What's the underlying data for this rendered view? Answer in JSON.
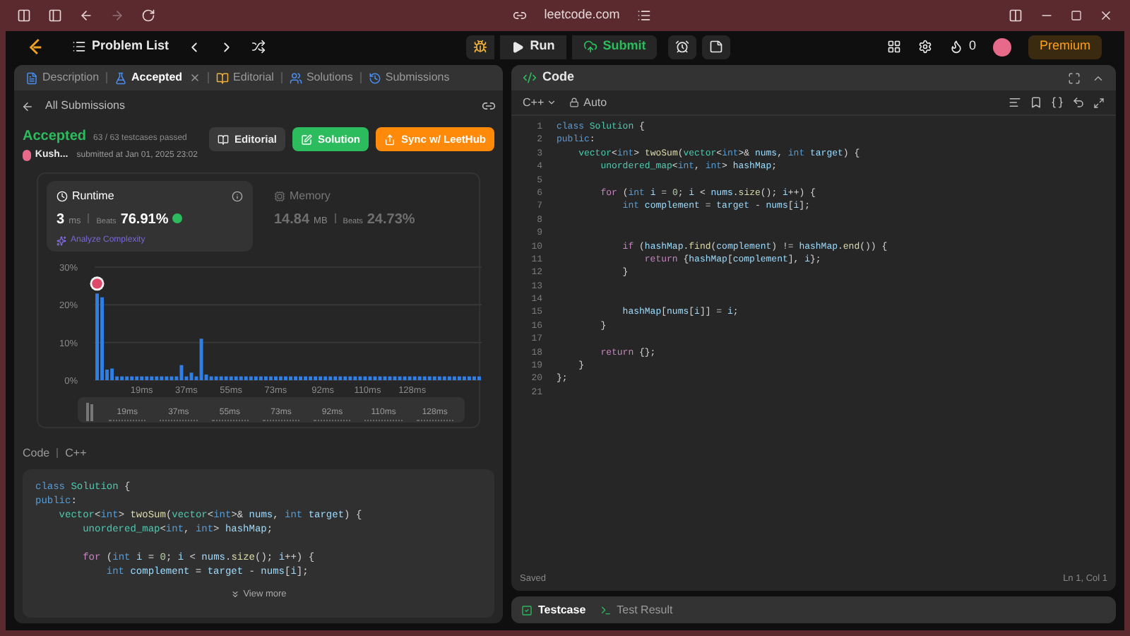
{
  "browser": {
    "url": "leetcode.com"
  },
  "nav": {
    "problem_list": "Problem List",
    "run": "Run",
    "submit": "Submit",
    "streak": "0",
    "premium": "Premium"
  },
  "left": {
    "tabs": [
      {
        "label": "Description",
        "selected": false,
        "closable": false
      },
      {
        "label": "Accepted",
        "selected": true,
        "closable": true
      },
      {
        "label": "Editorial",
        "selected": false,
        "closable": false
      },
      {
        "label": "Solutions",
        "selected": false,
        "closable": false
      },
      {
        "label": "Submissions",
        "selected": false,
        "closable": false
      }
    ],
    "back": "All Submissions",
    "status": "Accepted",
    "testcases": "63 / 63 testcases passed",
    "user": "Kush...",
    "submitted": "submitted at Jan 01, 2025 23:02",
    "actions": [
      {
        "label": "Editorial",
        "kind": "neutral"
      },
      {
        "label": "Solution",
        "kind": "green"
      },
      {
        "label": "Sync w/ LeetHub",
        "kind": "orange"
      }
    ],
    "stats": [
      {
        "title": "Runtime",
        "value": "3",
        "unit": "ms",
        "beats_label": "Beats",
        "beats": "76.91%",
        "selected": true,
        "link": "Analyze Complexity"
      },
      {
        "title": "Memory",
        "value": "14.84",
        "unit": "MB",
        "beats_label": "Beats",
        "beats": "24.73%",
        "selected": false
      }
    ],
    "chart_data": {
      "type": "bar",
      "xlim": [
        0,
        156
      ],
      "ylim": [
        0,
        30
      ],
      "yticks": [
        {
          "value": 0,
          "label": "0%"
        },
        {
          "value": 10,
          "label": "10%"
        },
        {
          "value": 20,
          "label": "20%"
        },
        {
          "value": 30,
          "label": "30%"
        }
      ],
      "xticks": [
        {
          "value": 19,
          "label": "19ms"
        },
        {
          "value": 37,
          "label": "37ms"
        },
        {
          "value": 55,
          "label": "55ms"
        },
        {
          "value": 73,
          "label": "73ms"
        },
        {
          "value": 92,
          "label": "92ms"
        },
        {
          "value": 110,
          "label": "110ms"
        },
        {
          "value": 128,
          "label": "128ms"
        }
      ],
      "x": [
        1,
        3,
        5,
        7,
        9,
        11,
        13,
        15,
        17,
        19,
        21,
        23,
        25,
        27,
        29,
        31,
        33,
        35,
        37,
        39,
        41,
        43,
        45,
        47,
        49,
        51,
        53,
        55,
        57,
        59,
        61,
        63,
        65,
        67,
        69,
        71,
        73,
        75,
        77,
        79,
        81,
        83,
        85,
        87,
        89,
        91,
        93,
        95,
        97,
        99,
        101,
        103,
        105,
        107,
        109,
        111,
        113,
        115,
        117,
        119,
        121,
        123,
        125,
        127,
        129,
        131,
        133,
        135,
        137,
        139,
        141,
        143,
        145,
        147,
        149,
        151,
        153,
        155
      ],
      "series": [
        {
          "color": "#2f7fe6",
          "values": [
            23,
            22,
            2.8,
            3.1,
            1,
            1,
            1,
            1,
            1,
            1,
            1,
            1,
            1,
            1,
            1,
            1,
            1,
            4,
            1,
            2,
            1,
            11,
            1.5,
            1,
            1,
            1,
            1,
            1,
            1,
            1,
            1,
            1,
            1,
            1,
            1,
            1,
            1,
            1,
            1,
            1,
            1,
            1,
            1,
            1,
            1,
            1,
            1,
            1,
            1,
            1,
            1,
            1,
            1,
            1,
            1,
            1,
            1,
            1,
            1,
            1,
            1,
            1,
            1,
            1,
            1,
            1,
            1,
            1,
            1,
            1,
            1,
            1,
            1,
            1,
            1,
            1,
            1,
            1
          ]
        }
      ]
    },
    "brush_labels": [
      "19ms",
      "37ms",
      "55ms",
      "73ms",
      "92ms",
      "110ms",
      "128ms"
    ],
    "code_label": "Code",
    "language": "C++",
    "code": [
      {
        "tokens": [
          {
            "kind": "k",
            "text": "class "
          },
          {
            "kind": "t",
            "text": "Solution"
          },
          {
            "kind": "p",
            "text": " {"
          }
        ]
      },
      {
        "tokens": [
          {
            "kind": "k",
            "text": "public"
          },
          {
            "kind": "p",
            "text": ":"
          }
        ]
      },
      {
        "tokens": [
          {
            "kind": "t",
            "text": "    vector"
          },
          {
            "kind": "p",
            "text": "<"
          },
          {
            "kind": "k",
            "text": "int"
          },
          {
            "kind": "p",
            "text": "> "
          },
          {
            "kind": "f",
            "text": "twoSum"
          },
          {
            "kind": "p",
            "text": "("
          },
          {
            "kind": "t",
            "text": "vector"
          },
          {
            "kind": "p",
            "text": "<"
          },
          {
            "kind": "k",
            "text": "int"
          },
          {
            "kind": "p",
            "text": ">& "
          },
          {
            "kind": "v",
            "text": "nums"
          },
          {
            "kind": "p",
            "text": ", "
          },
          {
            "kind": "k",
            "text": "int "
          },
          {
            "kind": "v",
            "text": "target"
          },
          {
            "kind": "p",
            "text": ") {"
          }
        ]
      },
      {
        "tokens": [
          {
            "kind": "t",
            "text": "        unordered_map"
          },
          {
            "kind": "p",
            "text": "<"
          },
          {
            "kind": "k",
            "text": "int"
          },
          {
            "kind": "p",
            "text": ", "
          },
          {
            "kind": "k",
            "text": "int"
          },
          {
            "kind": "p",
            "text": "> "
          },
          {
            "kind": "v",
            "text": "hashMap"
          },
          {
            "kind": "p",
            "text": ";"
          }
        ]
      },
      {
        "blank": true
      },
      {
        "tokens": [
          {
            "kind": "c",
            "text": "        for"
          },
          {
            "kind": "p",
            "text": " ("
          },
          {
            "kind": "k",
            "text": "int "
          },
          {
            "kind": "v",
            "text": "i"
          },
          {
            "kind": "p",
            "text": " = "
          },
          {
            "kind": "n",
            "text": "0"
          },
          {
            "kind": "p",
            "text": "; "
          },
          {
            "kind": "v",
            "text": "i"
          },
          {
            "kind": "p",
            "text": " < "
          },
          {
            "kind": "v",
            "text": "nums"
          },
          {
            "kind": "p",
            "text": "."
          },
          {
            "kind": "f",
            "text": "size"
          },
          {
            "kind": "p",
            "text": "(); "
          },
          {
            "kind": "v",
            "text": "i"
          },
          {
            "kind": "p",
            "text": "++) {"
          }
        ]
      },
      {
        "tokens": [
          {
            "kind": "k",
            "text": "            int "
          },
          {
            "kind": "v",
            "text": "complement"
          },
          {
            "kind": "p",
            "text": " = "
          },
          {
            "kind": "v",
            "text": "target"
          },
          {
            "kind": "p",
            "text": " - "
          },
          {
            "kind": "v",
            "text": "nums"
          },
          {
            "kind": "p",
            "text": "["
          },
          {
            "kind": "v",
            "text": "i"
          },
          {
            "kind": "p",
            "text": "];"
          }
        ]
      }
    ],
    "view_more": "View more"
  },
  "editor": {
    "title": "Code",
    "language": "C++",
    "mode": "Auto",
    "lines": [
      {
        "no": "1",
        "tokens": [
          {
            "kind": "k",
            "text": "class "
          },
          {
            "kind": "t",
            "text": "Solution"
          },
          {
            "kind": "p",
            "text": " {"
          }
        ]
      },
      {
        "no": "2",
        "tokens": [
          {
            "kind": "k",
            "text": "public"
          },
          {
            "kind": "p",
            "text": ":"
          }
        ]
      },
      {
        "no": "3",
        "tokens": [
          {
            "kind": "t",
            "text": "    vector"
          },
          {
            "kind": "p",
            "text": "<"
          },
          {
            "kind": "k",
            "text": "int"
          },
          {
            "kind": "p",
            "text": "> "
          },
          {
            "kind": "f",
            "text": "twoSum"
          },
          {
            "kind": "p",
            "text": "("
          },
          {
            "kind": "t",
            "text": "vector"
          },
          {
            "kind": "p",
            "text": "<"
          },
          {
            "kind": "k",
            "text": "int"
          },
          {
            "kind": "p",
            "text": ">& "
          },
          {
            "kind": "v",
            "text": "nums"
          },
          {
            "kind": "p",
            "text": ", "
          },
          {
            "kind": "k",
            "text": "int "
          },
          {
            "kind": "v",
            "text": "target"
          },
          {
            "kind": "p",
            "text": ") {"
          }
        ]
      },
      {
        "no": "4",
        "tokens": [
          {
            "kind": "t",
            "text": "        unordered_map"
          },
          {
            "kind": "p",
            "text": "<"
          },
          {
            "kind": "k",
            "text": "int"
          },
          {
            "kind": "p",
            "text": ", "
          },
          {
            "kind": "k",
            "text": "int"
          },
          {
            "kind": "p",
            "text": "> "
          },
          {
            "kind": "v",
            "text": "hashMap"
          },
          {
            "kind": "p",
            "text": ";"
          }
        ]
      },
      {
        "no": "5",
        "blank": true
      },
      {
        "no": "6",
        "tokens": [
          {
            "kind": "c",
            "text": "        for"
          },
          {
            "kind": "p",
            "text": " ("
          },
          {
            "kind": "k",
            "text": "int "
          },
          {
            "kind": "v",
            "text": "i"
          },
          {
            "kind": "p",
            "text": " = "
          },
          {
            "kind": "n",
            "text": "0"
          },
          {
            "kind": "p",
            "text": "; "
          },
          {
            "kind": "v",
            "text": "i"
          },
          {
            "kind": "p",
            "text": " < "
          },
          {
            "kind": "v",
            "text": "nums"
          },
          {
            "kind": "p",
            "text": "."
          },
          {
            "kind": "f",
            "text": "size"
          },
          {
            "kind": "p",
            "text": "(); "
          },
          {
            "kind": "v",
            "text": "i"
          },
          {
            "kind": "p",
            "text": "++) {"
          }
        ]
      },
      {
        "no": "7",
        "tokens": [
          {
            "kind": "k",
            "text": "            int "
          },
          {
            "kind": "v",
            "text": "complement"
          },
          {
            "kind": "p",
            "text": " = "
          },
          {
            "kind": "v",
            "text": "target"
          },
          {
            "kind": "p",
            "text": " - "
          },
          {
            "kind": "v",
            "text": "nums"
          },
          {
            "kind": "p",
            "text": "["
          },
          {
            "kind": "v",
            "text": "i"
          },
          {
            "kind": "p",
            "text": "];"
          }
        ]
      },
      {
        "no": "8",
        "blank": true
      },
      {
        "no": "9",
        "blank": true
      },
      {
        "no": "10",
        "tokens": [
          {
            "kind": "c",
            "text": "            if"
          },
          {
            "kind": "p",
            "text": " ("
          },
          {
            "kind": "v",
            "text": "hashMap"
          },
          {
            "kind": "p",
            "text": "."
          },
          {
            "kind": "f",
            "text": "find"
          },
          {
            "kind": "p",
            "text": "("
          },
          {
            "kind": "v",
            "text": "complement"
          },
          {
            "kind": "p",
            "text": ") != "
          },
          {
            "kind": "v",
            "text": "hashMap"
          },
          {
            "kind": "p",
            "text": "."
          },
          {
            "kind": "f",
            "text": "end"
          },
          {
            "kind": "p",
            "text": "()) {"
          }
        ]
      },
      {
        "no": "11",
        "tokens": [
          {
            "kind": "c",
            "text": "                return"
          },
          {
            "kind": "p",
            "text": " {"
          },
          {
            "kind": "v",
            "text": "hashMap"
          },
          {
            "kind": "p",
            "text": "["
          },
          {
            "kind": "v",
            "text": "complement"
          },
          {
            "kind": "p",
            "text": "], "
          },
          {
            "kind": "v",
            "text": "i"
          },
          {
            "kind": "p",
            "text": "};"
          }
        ]
      },
      {
        "no": "12",
        "tokens": [
          {
            "kind": "p",
            "text": "            }"
          }
        ]
      },
      {
        "no": "13",
        "blank": true
      },
      {
        "no": "14",
        "blank": true
      },
      {
        "no": "15",
        "tokens": [
          {
            "kind": "v",
            "text": "            hashMap"
          },
          {
            "kind": "p",
            "text": "["
          },
          {
            "kind": "v",
            "text": "nums"
          },
          {
            "kind": "p",
            "text": "["
          },
          {
            "kind": "v",
            "text": "i"
          },
          {
            "kind": "p",
            "text": "]] = "
          },
          {
            "kind": "v",
            "text": "i"
          },
          {
            "kind": "p",
            "text": ";"
          }
        ]
      },
      {
        "no": "16",
        "tokens": [
          {
            "kind": "p",
            "text": "        }"
          }
        ]
      },
      {
        "no": "17",
        "blank": true
      },
      {
        "no": "18",
        "tokens": [
          {
            "kind": "c",
            "text": "        return"
          },
          {
            "kind": "p",
            "text": " {};"
          }
        ]
      },
      {
        "no": "19",
        "tokens": [
          {
            "kind": "p",
            "text": "    }"
          }
        ]
      },
      {
        "no": "20",
        "tokens": [
          {
            "kind": "p",
            "text": "};"
          }
        ]
      },
      {
        "no": "21",
        "blank": true
      }
    ],
    "status": "Saved",
    "cursor": "Ln 1, Col 1"
  },
  "bottom_tabs": [
    {
      "label": "Testcase",
      "selected": true
    },
    {
      "label": "Test Result",
      "selected": false
    }
  ]
}
